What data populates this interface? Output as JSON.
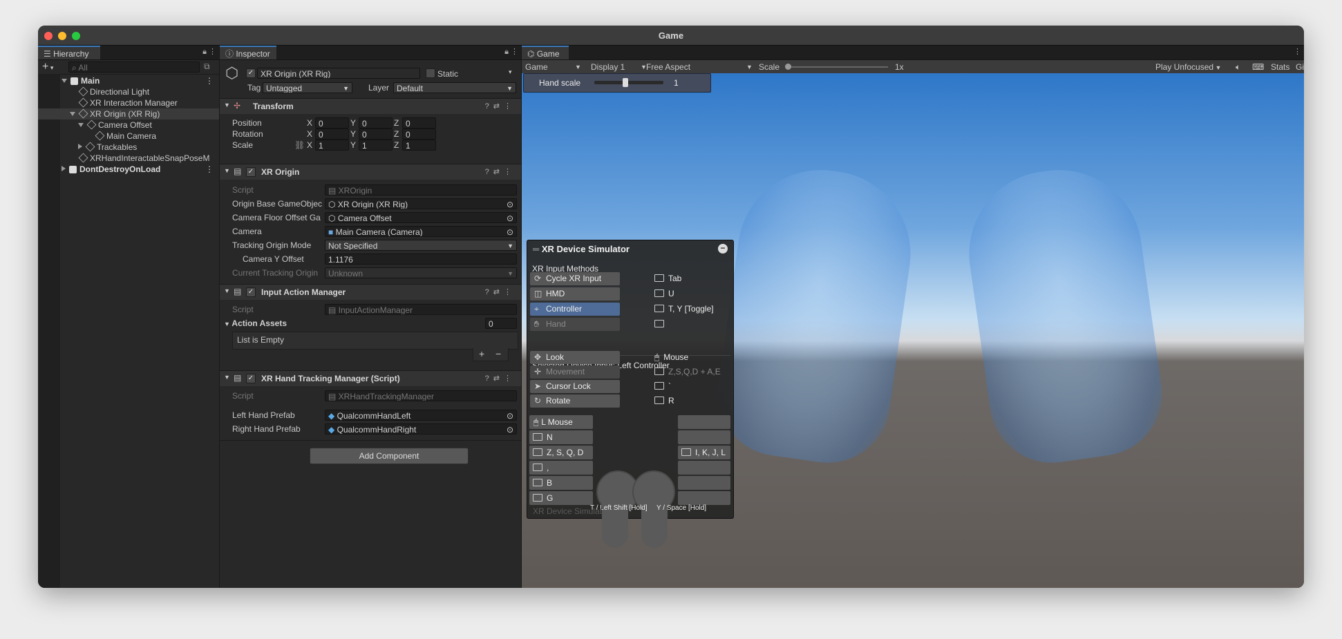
{
  "window": {
    "title": "Game"
  },
  "colors": {
    "accent": "#3a79bb",
    "selection": "#4e6c97",
    "traffic_red": "#ff5f57",
    "traffic_yellow": "#febc2e",
    "traffic_green": "#28c840"
  },
  "hierarchy": {
    "tab_label": "Hierarchy",
    "search_placeholder": "All",
    "add_label": "+",
    "items": [
      {
        "label": "Main",
        "depth": 0,
        "expanded": true,
        "scene": true
      },
      {
        "label": "Directional Light",
        "depth": 1
      },
      {
        "label": "XR Interaction Manager",
        "depth": 1
      },
      {
        "label": "XR Origin (XR Rig)",
        "depth": 1,
        "expanded": true,
        "selected": true
      },
      {
        "label": "Camera Offset",
        "depth": 2,
        "expanded": true
      },
      {
        "label": "Main Camera",
        "depth": 3
      },
      {
        "label": "Trackables",
        "depth": 2,
        "collapsed": true
      },
      {
        "label": "XRHandInteractableSnapPoseM",
        "depth": 1
      },
      {
        "label": "DontDestroyOnLoad",
        "depth": 0,
        "collapsed": true,
        "scene": true
      }
    ]
  },
  "inspector": {
    "tab_label": "Inspector",
    "object_name": "XR Origin (XR Rig)",
    "static_label": "Static",
    "tag_label": "Tag",
    "tag_value": "Untagged",
    "layer_label": "Layer",
    "layer_value": "Default",
    "transform": {
      "title": "Transform",
      "position_label": "Position",
      "rotation_label": "Rotation",
      "scale_label": "Scale",
      "x": "X",
      "y": "Y",
      "z": "Z",
      "position": [
        "0",
        "0",
        "0"
      ],
      "rotation": [
        "0",
        "0",
        "0"
      ],
      "scale": [
        "1",
        "1",
        "1"
      ]
    },
    "xr_origin": {
      "title": "XR Origin",
      "script_label": "Script",
      "script_value": "XROrigin",
      "origin_label": "Origin Base GameObjec",
      "origin_value": "XR Origin (XR Rig)",
      "floor_label": "Camera Floor Offset Ga",
      "floor_value": "Camera Offset",
      "camera_label": "Camera",
      "camera_value": "Main Camera (Camera)",
      "tracking_label": "Tracking Origin Mode",
      "tracking_value": "Not Specified",
      "yoffset_label": "Camera Y Offset",
      "yoffset_value": "1.1176",
      "current_label": "Current Tracking Origin",
      "current_value": "Unknown"
    },
    "input_action_manager": {
      "title": "Input Action Manager",
      "script_label": "Script",
      "script_value": "InputActionManager",
      "assets_label": "Action Assets",
      "assets_count": "0",
      "empty_label": "List is Empty",
      "plus": "+",
      "minus": "−"
    },
    "hand_tracking": {
      "title": "XR Hand Tracking Manager (Script)",
      "script_label": "Script",
      "script_value": "XRHandTrackingManager",
      "left_label": "Left Hand Prefab",
      "left_value": "QualcommHandLeft",
      "right_label": "Right Hand Prefab",
      "right_value": "QualcommHandRight"
    },
    "add_component": "Add Component"
  },
  "game": {
    "tab_label": "Game",
    "toolbar": {
      "view": "Game",
      "display": "Display 1",
      "aspect": "Free Aspect",
      "scale_label": "Scale",
      "scale_value": "1x",
      "play_mode": "Play Unfocused",
      "stats": "Stats",
      "gizmos": "Gizmos"
    },
    "hand_scale": {
      "label": "Hand scale",
      "value": "1",
      "slider_fraction": 0.45
    },
    "simulator": {
      "title": "XR Device Simulator",
      "methods_label": "XR Input Methods",
      "methods": [
        {
          "label": "Cycle XR Input",
          "key": "Tab",
          "icon": "cycle-icon"
        },
        {
          "label": "HMD",
          "key": "U",
          "icon": "hmd-icon"
        },
        {
          "label": "Controller",
          "key": "T, Y [Toggle]",
          "icon": "controller-icon",
          "selected": true
        },
        {
          "label": "Hand",
          "key": "",
          "icon": "hand-icon",
          "disabled": true
        }
      ],
      "selected_label": "Selected Device Input: Left Controller",
      "inputs": [
        {
          "label": "Look",
          "key": "Mouse",
          "icon": "move-arrows-icon"
        },
        {
          "label": "Movement",
          "key": "Z,S,Q,D + A,E",
          "icon": "dpad-icon",
          "disabled": true
        },
        {
          "label": "Cursor Lock",
          "key": "`",
          "icon": "cursor-icon"
        },
        {
          "label": "Rotate",
          "key": "R",
          "icon": "rotate-icon"
        }
      ],
      "left_bindings": [
        "L Mouse",
        "N",
        "Z, S, Q, D",
        ",",
        "B",
        "G"
      ],
      "right_bindings": [
        "",
        "",
        "I, K, J, L",
        "",
        "",
        ""
      ],
      "footer_left": "T / Left Shift [Hold]",
      "footer_right": "Y / Space [Hold]",
      "ghost_title": "XR Device Simulator"
    }
  }
}
